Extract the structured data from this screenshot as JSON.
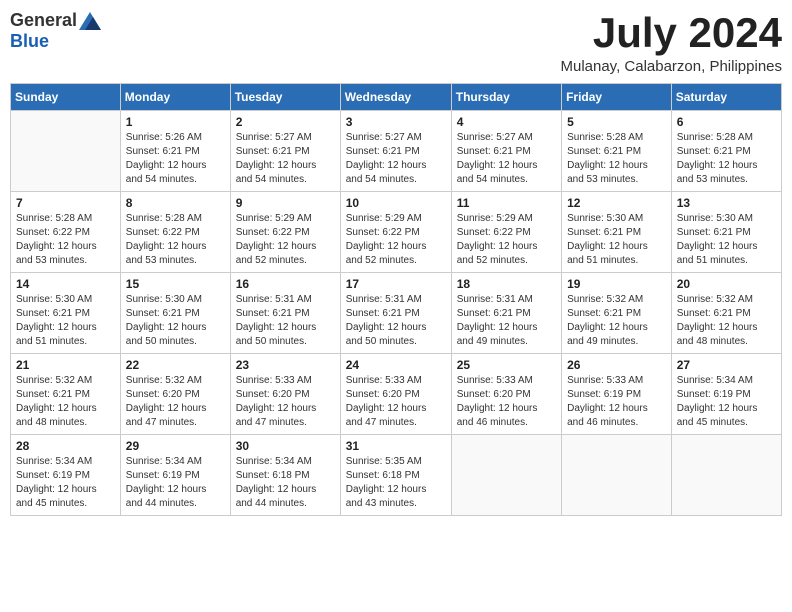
{
  "logo": {
    "general": "General",
    "blue": "Blue"
  },
  "title": {
    "month_year": "July 2024",
    "location": "Mulanay, Calabarzon, Philippines"
  },
  "days_of_week": [
    "Sunday",
    "Monday",
    "Tuesday",
    "Wednesday",
    "Thursday",
    "Friday",
    "Saturday"
  ],
  "weeks": [
    [
      {
        "day": "",
        "info": ""
      },
      {
        "day": "1",
        "info": "Sunrise: 5:26 AM\nSunset: 6:21 PM\nDaylight: 12 hours\nand 54 minutes."
      },
      {
        "day": "2",
        "info": "Sunrise: 5:27 AM\nSunset: 6:21 PM\nDaylight: 12 hours\nand 54 minutes."
      },
      {
        "day": "3",
        "info": "Sunrise: 5:27 AM\nSunset: 6:21 PM\nDaylight: 12 hours\nand 54 minutes."
      },
      {
        "day": "4",
        "info": "Sunrise: 5:27 AM\nSunset: 6:21 PM\nDaylight: 12 hours\nand 54 minutes."
      },
      {
        "day": "5",
        "info": "Sunrise: 5:28 AM\nSunset: 6:21 PM\nDaylight: 12 hours\nand 53 minutes."
      },
      {
        "day": "6",
        "info": "Sunrise: 5:28 AM\nSunset: 6:21 PM\nDaylight: 12 hours\nand 53 minutes."
      }
    ],
    [
      {
        "day": "7",
        "info": "Sunrise: 5:28 AM\nSunset: 6:22 PM\nDaylight: 12 hours\nand 53 minutes."
      },
      {
        "day": "8",
        "info": "Sunrise: 5:28 AM\nSunset: 6:22 PM\nDaylight: 12 hours\nand 53 minutes."
      },
      {
        "day": "9",
        "info": "Sunrise: 5:29 AM\nSunset: 6:22 PM\nDaylight: 12 hours\nand 52 minutes."
      },
      {
        "day": "10",
        "info": "Sunrise: 5:29 AM\nSunset: 6:22 PM\nDaylight: 12 hours\nand 52 minutes."
      },
      {
        "day": "11",
        "info": "Sunrise: 5:29 AM\nSunset: 6:22 PM\nDaylight: 12 hours\nand 52 minutes."
      },
      {
        "day": "12",
        "info": "Sunrise: 5:30 AM\nSunset: 6:21 PM\nDaylight: 12 hours\nand 51 minutes."
      },
      {
        "day": "13",
        "info": "Sunrise: 5:30 AM\nSunset: 6:21 PM\nDaylight: 12 hours\nand 51 minutes."
      }
    ],
    [
      {
        "day": "14",
        "info": "Sunrise: 5:30 AM\nSunset: 6:21 PM\nDaylight: 12 hours\nand 51 minutes."
      },
      {
        "day": "15",
        "info": "Sunrise: 5:30 AM\nSunset: 6:21 PM\nDaylight: 12 hours\nand 50 minutes."
      },
      {
        "day": "16",
        "info": "Sunrise: 5:31 AM\nSunset: 6:21 PM\nDaylight: 12 hours\nand 50 minutes."
      },
      {
        "day": "17",
        "info": "Sunrise: 5:31 AM\nSunset: 6:21 PM\nDaylight: 12 hours\nand 50 minutes."
      },
      {
        "day": "18",
        "info": "Sunrise: 5:31 AM\nSunset: 6:21 PM\nDaylight: 12 hours\nand 49 minutes."
      },
      {
        "day": "19",
        "info": "Sunrise: 5:32 AM\nSunset: 6:21 PM\nDaylight: 12 hours\nand 49 minutes."
      },
      {
        "day": "20",
        "info": "Sunrise: 5:32 AM\nSunset: 6:21 PM\nDaylight: 12 hours\nand 48 minutes."
      }
    ],
    [
      {
        "day": "21",
        "info": "Sunrise: 5:32 AM\nSunset: 6:21 PM\nDaylight: 12 hours\nand 48 minutes."
      },
      {
        "day": "22",
        "info": "Sunrise: 5:32 AM\nSunset: 6:20 PM\nDaylight: 12 hours\nand 47 minutes."
      },
      {
        "day": "23",
        "info": "Sunrise: 5:33 AM\nSunset: 6:20 PM\nDaylight: 12 hours\nand 47 minutes."
      },
      {
        "day": "24",
        "info": "Sunrise: 5:33 AM\nSunset: 6:20 PM\nDaylight: 12 hours\nand 47 minutes."
      },
      {
        "day": "25",
        "info": "Sunrise: 5:33 AM\nSunset: 6:20 PM\nDaylight: 12 hours\nand 46 minutes."
      },
      {
        "day": "26",
        "info": "Sunrise: 5:33 AM\nSunset: 6:19 PM\nDaylight: 12 hours\nand 46 minutes."
      },
      {
        "day": "27",
        "info": "Sunrise: 5:34 AM\nSunset: 6:19 PM\nDaylight: 12 hours\nand 45 minutes."
      }
    ],
    [
      {
        "day": "28",
        "info": "Sunrise: 5:34 AM\nSunset: 6:19 PM\nDaylight: 12 hours\nand 45 minutes."
      },
      {
        "day": "29",
        "info": "Sunrise: 5:34 AM\nSunset: 6:19 PM\nDaylight: 12 hours\nand 44 minutes."
      },
      {
        "day": "30",
        "info": "Sunrise: 5:34 AM\nSunset: 6:18 PM\nDaylight: 12 hours\nand 44 minutes."
      },
      {
        "day": "31",
        "info": "Sunrise: 5:35 AM\nSunset: 6:18 PM\nDaylight: 12 hours\nand 43 minutes."
      },
      {
        "day": "",
        "info": ""
      },
      {
        "day": "",
        "info": ""
      },
      {
        "day": "",
        "info": ""
      }
    ]
  ]
}
